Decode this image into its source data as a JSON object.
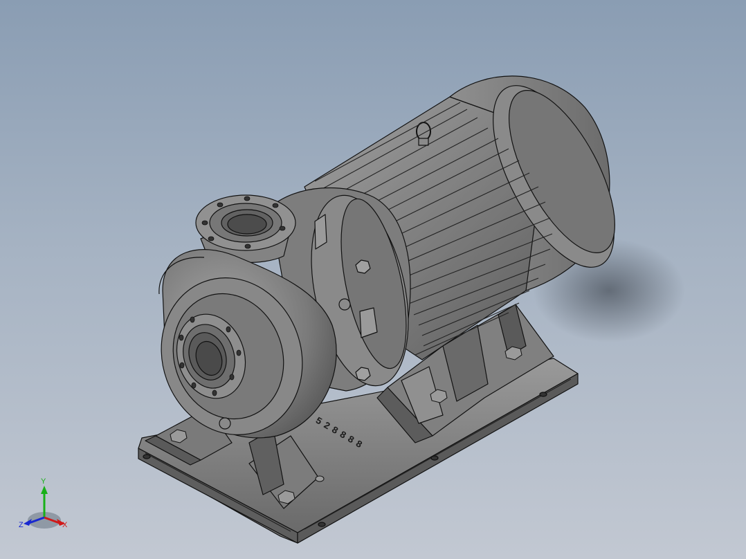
{
  "model": {
    "engraved_text": "528888"
  },
  "triad": {
    "x_label": "X",
    "y_label": "Y",
    "z_label": "Z",
    "colors": {
      "x": "#d01818",
      "y": "#18b018",
      "z": "#1828d0"
    }
  },
  "colors": {
    "background_top": "#8a9db3",
    "background_bottom": "#c2c8d2",
    "model_fill": "#8c8c8c",
    "model_dark": "#4a4a4a",
    "edge": "#111111"
  }
}
